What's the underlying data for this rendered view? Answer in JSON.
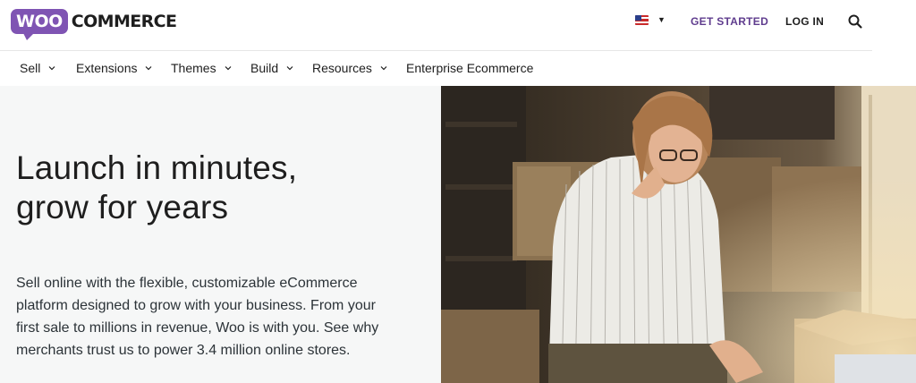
{
  "header": {
    "logo_badge": "WOO",
    "logo_text": "COMMERCE",
    "locale_flag": "us-flag-icon",
    "get_started": "GET STARTED",
    "log_in": "LOG IN",
    "search_icon": "search-icon"
  },
  "nav": {
    "items": [
      {
        "label": "Sell",
        "dropdown": true
      },
      {
        "label": "Extensions",
        "dropdown": true
      },
      {
        "label": "Themes",
        "dropdown": true
      },
      {
        "label": "Build",
        "dropdown": true
      },
      {
        "label": "Resources",
        "dropdown": true
      },
      {
        "label": "Enterprise Ecommerce",
        "dropdown": false
      }
    ]
  },
  "hero": {
    "title_line1": "Launch in minutes,",
    "title_line2": "grow for years",
    "description": "Sell online with the flexible, customizable eCommerce platform designed to grow with your business. From your first sale to millions in revenue, Woo is with you. See why merchants trust us to power 3.4 million online stores."
  },
  "colors": {
    "brand_purple": "#7f54b3",
    "cta_purple": "#5f3c8e",
    "hero_bg": "#f6f7f7",
    "text": "#1e1e1e"
  }
}
